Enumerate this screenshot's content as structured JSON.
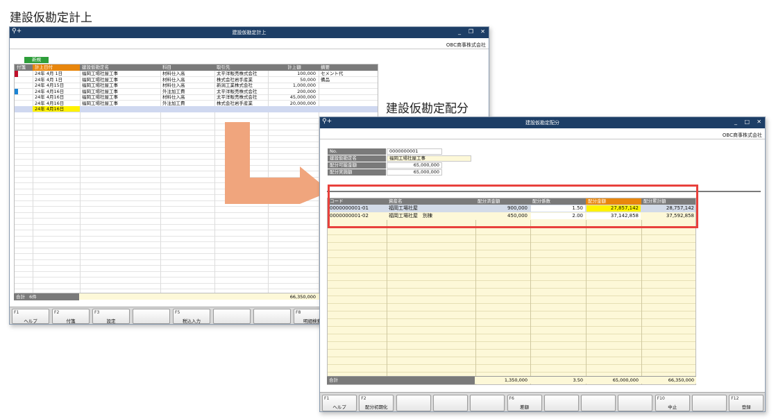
{
  "captions": {
    "left_heading": "建設仮勘定計上",
    "right_heading": "建設仮勘定配分"
  },
  "left_window": {
    "title": "建設仮勘定計上",
    "company": "OBC商事株式会社",
    "new_button": "新規",
    "columns": [
      "付箋",
      "計上日付",
      "建設仮勘定名",
      "科目",
      "取引先",
      "計上額",
      "摘要"
    ],
    "rows": [
      {
        "date": "24年 4月 1日",
        "name": "福岡工場社屋工事",
        "account": "材料仕入高",
        "vendor": "太平洋販売株式会社",
        "amount": "100,000",
        "memo": "セメント代",
        "tag": "red"
      },
      {
        "date": "24年 4月 1日",
        "name": "福岡工場社屋工事",
        "account": "材料仕入高",
        "vendor": "株式会社岩手産業",
        "amount": "50,000",
        "memo": "備品",
        "tag": ""
      },
      {
        "date": "24年 4月15日",
        "name": "福岡工場社屋工事",
        "account": "材料仕入高",
        "vendor": "新潟工業株式会社",
        "amount": "1,000,000",
        "memo": "",
        "tag": ""
      },
      {
        "date": "24年 4月16日",
        "name": "福岡工場社屋工事",
        "account": "外注加工費",
        "vendor": "太平洋販売株式会社",
        "amount": "200,000",
        "memo": "",
        "tag": "blue"
      },
      {
        "date": "24年 4月16日",
        "name": "福岡工場社屋工事",
        "account": "材料仕入高",
        "vendor": "太平洋販売株式会社",
        "amount": "45,000,000",
        "memo": "",
        "tag": ""
      },
      {
        "date": "24年 4月16日",
        "name": "福岡工場社屋工事",
        "account": "外注加工費",
        "vendor": "株式会社岩手産業",
        "amount": "20,000,000",
        "memo": "",
        "tag": ""
      }
    ],
    "edit_row_date": "24年 4月16日",
    "total_label": "合計",
    "total_count": "6件",
    "total_amount": "66,350,000",
    "fkeys": [
      {
        "key": "F1",
        "label": "ヘルプ"
      },
      {
        "key": "F2",
        "label": "付箋"
      },
      {
        "key": "F3",
        "label": "設定"
      },
      {
        "key": "",
        "label": ""
      },
      {
        "key": "F5",
        "label": "税込入力"
      },
      {
        "key": "",
        "label": ""
      },
      {
        "key": "",
        "label": ""
      },
      {
        "key": "F8",
        "label": "明細検索"
      }
    ]
  },
  "right_window": {
    "title": "建設仮勘定配分",
    "company": "OBC商事株式会社",
    "info": [
      {
        "label": "No.",
        "value": "0000000001"
      },
      {
        "label": "建設仮勘定名",
        "value": "福岡工場社屋工事"
      },
      {
        "label": "配分可能金額",
        "value": "65,000,000"
      },
      {
        "label": "配分実施額",
        "value": "65,000,000"
      }
    ],
    "columns": [
      "コード",
      "資産名",
      "配分済金額",
      "配分係数",
      "配分金額",
      "配分累計額"
    ],
    "rows": [
      {
        "code": "0000000001-01",
        "asset": "福岡工場社屋",
        "allocated": "900,000",
        "coef": "1.50",
        "amount": "27,857,142",
        "cumulative": "28,757,142"
      },
      {
        "code": "0000000001-02",
        "asset": "福岡工場社屋　別棟",
        "allocated": "450,000",
        "coef": "2.00",
        "amount": "37,142,858",
        "cumulative": "37,592,858"
      }
    ],
    "total_label": "合計",
    "total_allocated": "1,350,000",
    "total_coef": "3.50",
    "total_amount": "65,000,000",
    "total_cumulative": "66,350,000",
    "fkeys": [
      {
        "key": "F1",
        "label": "ヘルプ"
      },
      {
        "key": "F2",
        "label": "配分初期化"
      },
      {
        "key": "",
        "label": ""
      },
      {
        "key": "",
        "label": ""
      },
      {
        "key": "",
        "label": ""
      },
      {
        "key": "F6",
        "label": "差額"
      },
      {
        "key": "",
        "label": ""
      },
      {
        "key": "",
        "label": ""
      },
      {
        "key": "",
        "label": ""
      },
      {
        "key": "F10",
        "label": "中止"
      },
      {
        "key": "",
        "label": ""
      },
      {
        "key": "F12",
        "label": "登録"
      }
    ]
  },
  "colors": {
    "titlebar": "#1d3e66",
    "header_gray": "#7a7a7a",
    "header_orange": "#e8860c",
    "row_yellow": "#fdf8d8",
    "highlight_red": "#e8413c",
    "arrow": "#f0a57d"
  }
}
